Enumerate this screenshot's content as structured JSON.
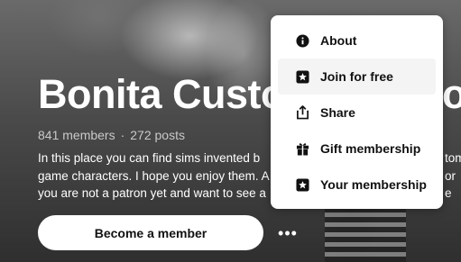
{
  "page": {
    "title": "Bonita Custo",
    "title_tail": "o",
    "stats": {
      "members": "841 members",
      "separator": "·",
      "posts": "272 posts"
    },
    "description": [
      "In this place you can find sims invented b",
      "game characters. I hope you enjoy them. A",
      "you are not a patron yet and want to see a"
    ],
    "description_right": [
      "tom",
      "or",
      "e"
    ],
    "become_label": "Become a member",
    "more_label": "•••"
  },
  "menu": {
    "items": [
      {
        "label": "About",
        "icon": "info-icon"
      },
      {
        "label": "Join for free",
        "icon": "star-badge-icon"
      },
      {
        "label": "Share",
        "icon": "share-icon"
      },
      {
        "label": "Gift membership",
        "icon": "gift-icon"
      },
      {
        "label": "Your membership",
        "icon": "star-badge-icon"
      }
    ]
  }
}
